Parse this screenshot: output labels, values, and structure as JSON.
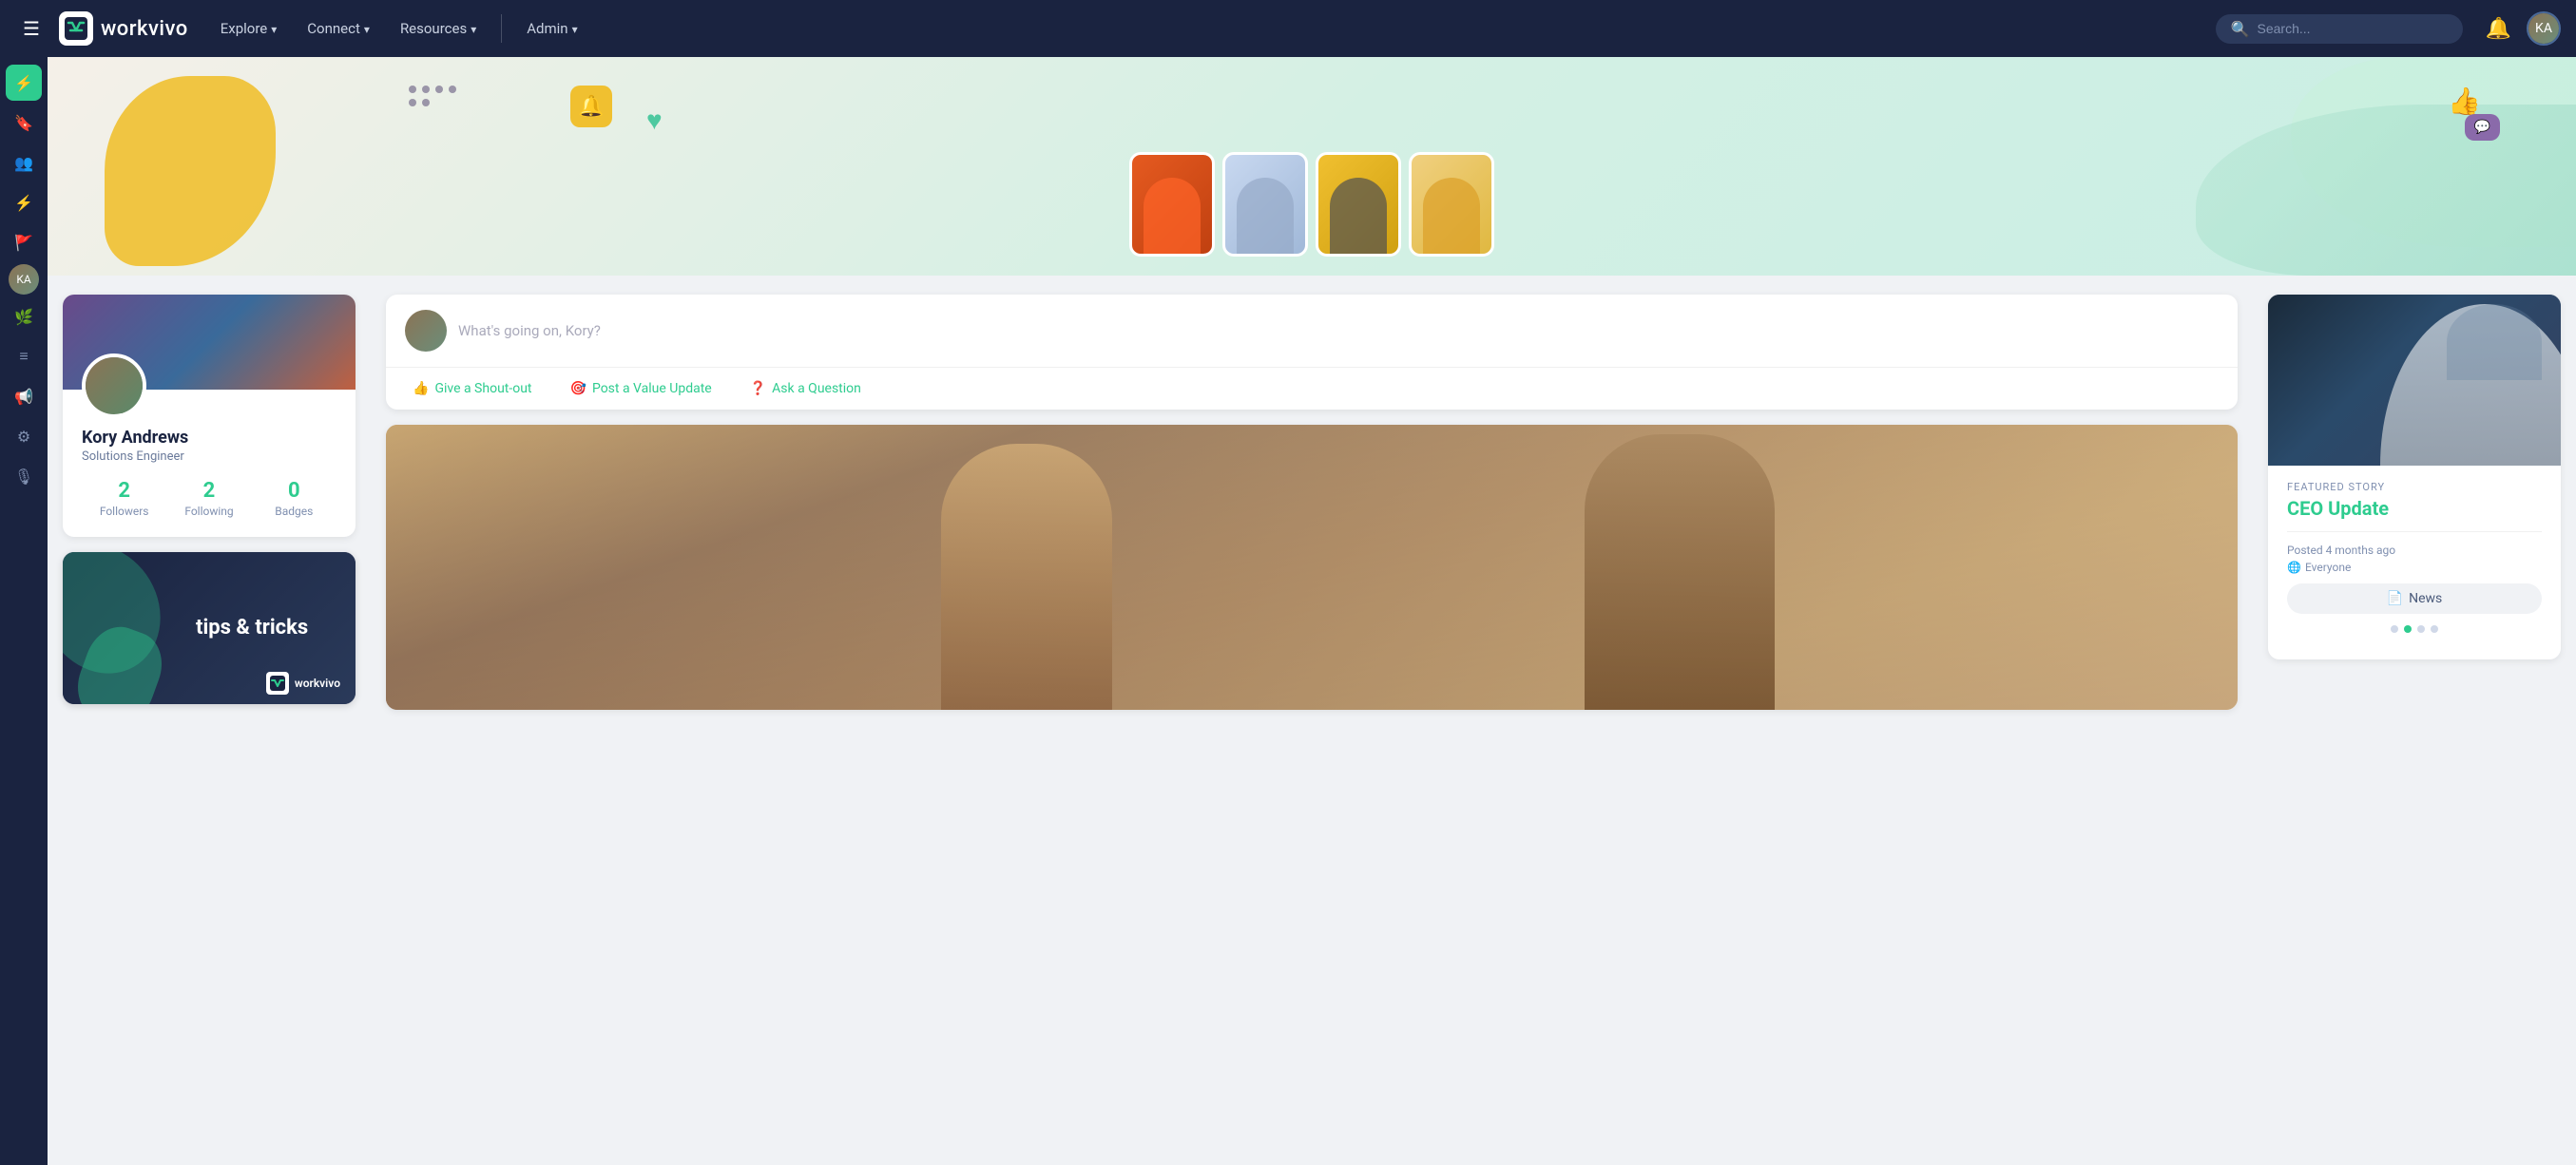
{
  "app": {
    "name": "workvivo"
  },
  "topnav": {
    "menu_icon": "☰",
    "nav_items": [
      {
        "label": "Explore",
        "has_dropdown": true
      },
      {
        "label": "Connect",
        "has_dropdown": true
      },
      {
        "label": "Resources",
        "has_dropdown": true
      },
      {
        "label": "Admin",
        "has_dropdown": true
      }
    ],
    "search_placeholder": "Search..."
  },
  "sidebar": {
    "items": [
      {
        "icon": "⚡",
        "name": "activity",
        "active": true
      },
      {
        "icon": "🔖",
        "name": "bookmarks",
        "active": false
      },
      {
        "icon": "👥",
        "name": "people",
        "active": false
      },
      {
        "icon": "⚡",
        "name": "feed",
        "active": false
      },
      {
        "icon": "🚩",
        "name": "flags",
        "active": false
      },
      {
        "icon": "🌿",
        "name": "nature",
        "active": false
      },
      {
        "icon": "≡",
        "name": "layers",
        "active": false
      },
      {
        "icon": "📢",
        "name": "announcements",
        "active": false
      },
      {
        "icon": "⚙",
        "name": "settings",
        "active": false
      },
      {
        "icon": "🎙",
        "name": "broadcast",
        "active": false
      }
    ]
  },
  "profile": {
    "name": "Kory Andrews",
    "role": "Solutions Engineer",
    "followers": 2,
    "following": 2,
    "badges": 0,
    "followers_label": "Followers",
    "following_label": "Following",
    "badges_label": "Badges"
  },
  "tips": {
    "title": "tips &\ntricks",
    "logo_text": "workvivo"
  },
  "post_box": {
    "placeholder": "What's going on, Kory?",
    "actions": [
      {
        "icon": "👍",
        "label": "Give a Shout-out"
      },
      {
        "icon": "🎯",
        "label": "Post a Value Update"
      },
      {
        "icon": "❓",
        "label": "Ask a Question"
      }
    ]
  },
  "featured": {
    "label": "FEATURED STORY",
    "title": "CEO Update",
    "date": "Posted 4 months ago",
    "audience": "Everyone",
    "tag": "News",
    "dots": [
      {
        "active": false
      },
      {
        "active": true
      },
      {
        "active": false
      },
      {
        "active": false
      }
    ]
  }
}
